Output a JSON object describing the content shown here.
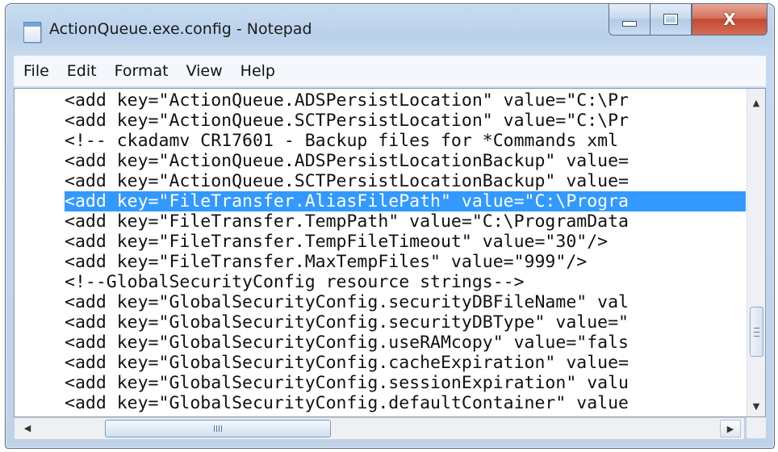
{
  "window": {
    "title": "ActionQueue.exe.config - Notepad",
    "close_glyph": "X"
  },
  "menu": [
    {
      "label": "File"
    },
    {
      "label": "Edit"
    },
    {
      "label": "Format"
    },
    {
      "label": "View"
    },
    {
      "label": "Help"
    }
  ],
  "document": {
    "lines": [
      "<add key=\"ActionQueue.ADSPersistLocation\" value=\"C:\\Pr",
      "<add key=\"ActionQueue.SCTPersistLocation\" value=\"C:\\Pr",
      "<!-- ckadamv CR17601 - Backup files for *Commands xml",
      "<add key=\"ActionQueue.ADSPersistLocationBackup\" value=",
      "<add key=\"ActionQueue.SCTPersistLocationBackup\" value=",
      "<add key=\"FileTransfer.AliasFilePath\" value=\"C:\\Progra",
      "<add key=\"FileTransfer.TempPath\" value=\"C:\\ProgramData",
      "<add key=\"FileTransfer.TempFileTimeout\" value=\"30\"/>",
      "<add key=\"FileTransfer.MaxTempFiles\" value=\"999\"/>",
      "<!--GlobalSecurityConfig resource strings-->",
      "<add key=\"GlobalSecurityConfig.securityDBFileName\" val",
      "<add key=\"GlobalSecurityConfig.securityDBType\" value=\"",
      "<add key=\"GlobalSecurityConfig.useRAMcopy\" value=\"fals",
      "<add key=\"GlobalSecurityConfig.cacheExpiration\" value=",
      "<add key=\"GlobalSecurityConfig.sessionExpiration\" valu",
      "<add key=\"GlobalSecurityConfig.defaultContainer\" value"
    ]
  },
  "colors": {
    "selection": "#3399ff",
    "selection_text": "#ffffff",
    "close_button": "#c9503a"
  },
  "icons": {
    "app": "notepad-icon",
    "minimize": "minimize-icon",
    "maximize": "maximize-icon",
    "close": "close-icon",
    "scroll_up": "triangle-up-icon",
    "scroll_down": "triangle-down-icon",
    "scroll_left": "triangle-left-icon",
    "scroll_right": "triangle-right-icon"
  }
}
